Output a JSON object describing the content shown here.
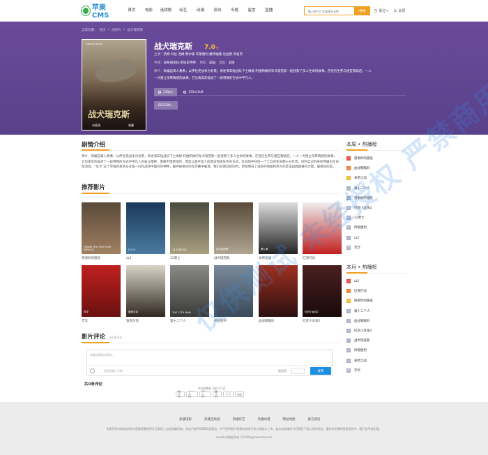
{
  "header": {
    "logo_text": "苹果CMS",
    "nav": [
      "首页",
      "电影",
      "连续剧",
      "综艺",
      "动漫",
      "资讯",
      "专题",
      "留言",
      "直播"
    ],
    "search_placeholder": "输入影片片名或演员名称",
    "search_button": "搜索",
    "history_label": "看过",
    "member_label": "会员"
  },
  "breadcrumb": [
    "当前位置：",
    "首页",
    "战争片",
    "战犬瑞克斯"
  ],
  "movie": {
    "title": "战犬瑞克斯",
    "score": "7.0",
    "score_unit": "分",
    "poster_title": "战犬瑞克斯",
    "poster_top": "MEGAN LEAVEY",
    "poster_bottom_left": "诗恩演",
    "poster_bottom_right": "收藏",
    "cast_label": "主演：",
    "cast": "凯特·玛拉  汤姆·费尔顿  布莱德利·惠特福德  达拉斯·罗伯茨",
    "director_label": "导演：",
    "director": "加布丽埃拉·考珀思韦特",
    "region_label": "地区：",
    "region": "美国",
    "genre_label": "类型：",
    "genre": "战争",
    "intro_label": "简介：",
    "intro_short_1": "改编自真人真事，以伊拉克战争为背景，讲述海军陆战队下士梅根·利维和她的军犬瑞克斯一起拯救了多人生命的故事。在经历生死与相互救赎后，一人",
    "intro_short_2": "一犬建立深厚情感的故事。它也真实的描述了一段特殊的方式中平凡人。"
  },
  "play_sources": [
    "135zy",
    "135m3u8"
  ],
  "episodes": [
    "BD1280..."
  ],
  "intro_section": {
    "title": "剧情介绍",
    "text": "简介：改编自真人真事，以伊拉克战争为背景，讲述海军陆战队下士梅根·利维和她的军犬瑞克斯一起拯救了多人生命的故事。在经历生死与相互救赎后，一人一犬建立深厚情感的故事。它也真实的描述了一段特殊的方式中平凡人的奋斗精神，勇敢不惧害怕的，而是以超乎常人的意志完成任务的方式。在战场中任何一个士兵的生命都十分珍贵，同时自己的身体疼痛也在日渐消退，“军犬”这个单独的角色与主角一同在战场中面对的种种，最终被很好的在荧幕中展现，我们在感动的同时，更加明白了战争的残酷和伟大的友谊战胜困难的力量。最感动的是。"
  },
  "recommend": {
    "title": "推荐影片",
    "items": [
      {
        "caption": "感谢你的服役",
        "color1": "#5a4a3a",
        "color2": "#a08060",
        "poster": "THANK YOU FOR YOUR SERVICE"
      },
      {
        "caption": "山2",
        "color1": "#1a3a5a",
        "color2": "#4a7aa0",
        "poster": "D A G"
      },
      {
        "caption": "12勇士",
        "color1": "#4a4a40",
        "color2": "#aaa080",
        "poster": "12 STRONG"
      },
      {
        "caption": "战犬瑞克斯",
        "color1": "#5a4a3a",
        "color2": "#b0a590",
        "poster": "战犬瑞克斯"
      },
      {
        "caption": "关原之战",
        "color1": "#ddd",
        "color2": "#222",
        "poster": "関ヶ原"
      },
      {
        "caption": "红海行动",
        "color1": "#eee",
        "color2": "#c02020",
        "poster": ""
      },
      {
        "caption": "芳华",
        "color1": "#c02020",
        "color2": "#6a1010",
        "poster": "芳华"
      },
      {
        "caption": "敦刻尔克",
        "color1": "#d8d4c8",
        "color2": "#302820",
        "poster": "敦刻尔克"
      },
      {
        "caption": "第十二个人",
        "color1": "#8a8a88",
        "color2": "#3a3a38",
        "poster": "THE 12TH MAN"
      },
      {
        "caption": "终极胜利",
        "color1": "#7a8a9a",
        "color2": "#3a4a5a",
        "poster": ""
      },
      {
        "caption": "血战钢锯岭",
        "color1": "#a03020",
        "color2": "#2a1010",
        "poster": ""
      },
      {
        "caption": "红衣小女孩2",
        "color1": "#4a2020",
        "color2": "#1a0a0a",
        "poster": "紅衣小女孩2"
      }
    ]
  },
  "comments": {
    "title": "影片评论",
    "sub": "共0条评论",
    "box_placeholder": "有事没事留言两句...",
    "hint": "您说段能个200",
    "captcha_label": "验证码",
    "submit": "发布",
    "count_title": "共0条评论",
    "pager_info": "共0条数据 当前:1/1页",
    "pager": [
      "首页",
      "上一页",
      "下一页",
      "尾页",
      "GO"
    ],
    "page_input": "页码"
  },
  "weekly": {
    "title": "本周 • 热播榜",
    "items": [
      "感谢你的服役",
      "血战钢锯岭",
      "关原之战",
      "第十二个人",
      "感谢你的服役",
      "红衣小女孩2",
      "12勇士",
      "终极胜利",
      "山2",
      "芳华"
    ]
  },
  "monthly": {
    "title": "本月 • 热播榜",
    "items": [
      "山2",
      "红海行动",
      "感谢你的服役",
      "第十二个人",
      "血战钢锯岭",
      "红衣小女孩2",
      "战犬瑞克斯",
      "终极胜利",
      "关原之战",
      "芳华"
    ]
  },
  "rank_colors": [
    "#e84c3d",
    "#f07a30",
    "#f0b830",
    "#a8b0c8"
  ],
  "footer": {
    "links": [
      "热播电影",
      "热播连续剧",
      "热播综艺",
      "热播动漫",
      "网站地图",
      "留言建议"
    ],
    "disclaimer": "免责声明:本网站所有内容都是靠程序在互联网上自动搜集而来，本站只提供WEB页面服务，并不提供影片资源存储也不参与录制与上传，若本站收录的节目侵犯了您公司的权益，请附有完整的版权证明书，我们会尽快处理。",
    "contact": "localhost版权所有 123456@maccms.com"
  },
  "watermark": "仅供测试 未经授权 严禁商用"
}
